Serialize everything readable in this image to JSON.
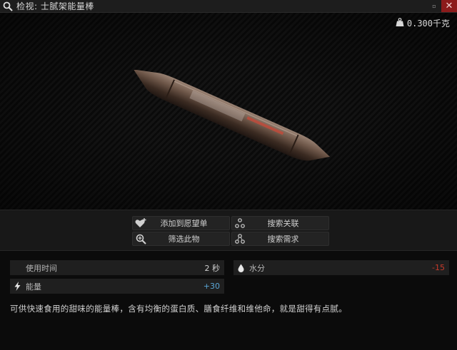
{
  "window": {
    "title": "检视: 士腻架能量棒",
    "minimize_glyph": "▫",
    "close_glyph": "✕"
  },
  "item": {
    "weight": "0.300千克"
  },
  "actions": {
    "add_wishlist": "添加到愿望单",
    "search_related": "搜索关联",
    "filter_item": "筛选此物",
    "search_needs": "搜索需求"
  },
  "stats": {
    "use_time": {
      "label": "使用时间",
      "value": "2 秒"
    },
    "hydration": {
      "label": "水分",
      "value": "-15",
      "color": "#c83a2a"
    },
    "energy": {
      "label": "能量",
      "value": "+30",
      "color": "#5aa6d6"
    }
  },
  "description": "可供快速食用的甜味的能量棒，含有均衡的蛋白质、膳食纤维和维他命，就是甜得有点腻。"
}
